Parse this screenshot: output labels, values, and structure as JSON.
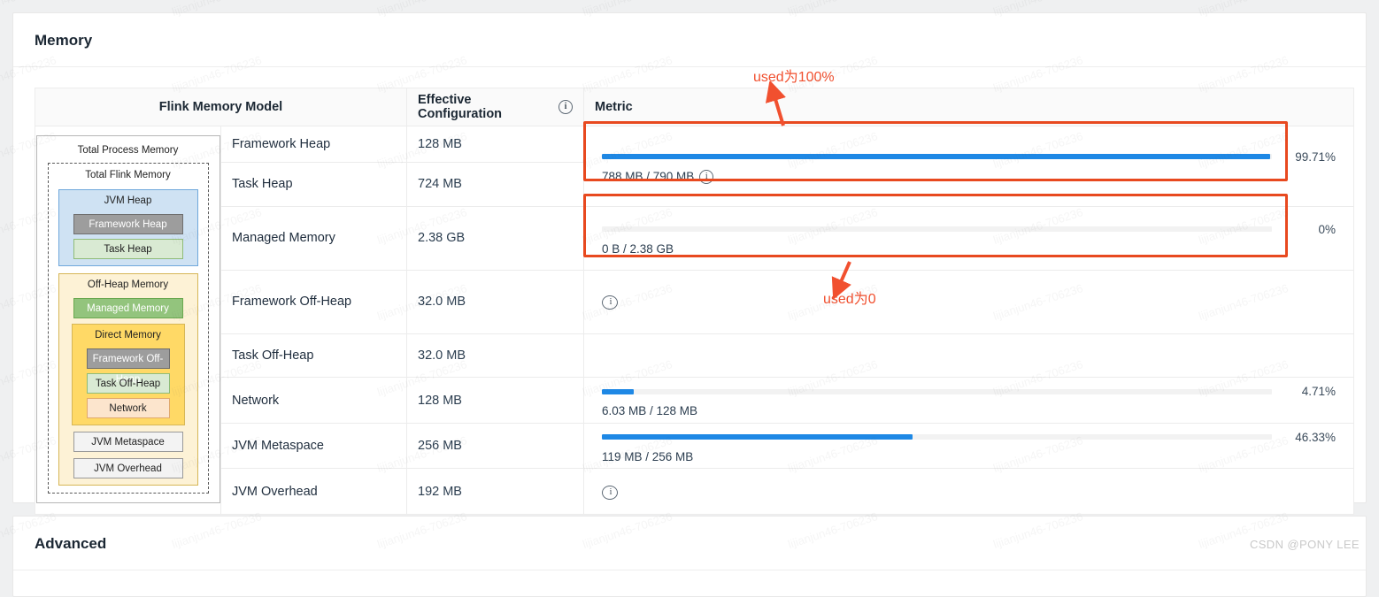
{
  "page": {
    "memory_title": "Memory",
    "advanced_title": "Advanced",
    "watermark": "CSDN @PONY LEE",
    "tile_watermark": "lijianjun46-706236"
  },
  "colors": {
    "bar_fill": "#1e88e5",
    "bar_track": "#f2f2f2",
    "highlight": "#e8491f",
    "annotation": "#f1502f",
    "jvm_heap": "#cfe2f3",
    "off_heap": "#fdf2d6",
    "direct_memory": "#ffd966",
    "framework_gray": "#9d9d9d",
    "task_green": "#d9ead3",
    "managed_green": "#93c47d",
    "network_peach": "#fce5cd",
    "plain_gray": "#f3f3f3"
  },
  "table": {
    "headers": {
      "model": "Flink Memory Model",
      "configuration": "Effective Configuration",
      "configuration_info_icon": "info-icon",
      "metric": "Metric"
    },
    "rows": [
      {
        "name": "Framework Heap",
        "configuration": "128 MB"
      },
      {
        "name": "Task Heap",
        "configuration": "724 MB"
      },
      {
        "name": "Managed Memory",
        "configuration": "2.38 GB"
      },
      {
        "name": "Framework Off-Heap",
        "configuration": "32.0 MB"
      },
      {
        "name": "Task Off-Heap",
        "configuration": "32.0 MB"
      },
      {
        "name": "Network",
        "configuration": "128 MB"
      },
      {
        "name": "JVM Metaspace",
        "configuration": "256 MB"
      },
      {
        "name": "JVM Overhead",
        "configuration": "192 MB"
      }
    ],
    "metrics": {
      "heap": {
        "percent_label": "99.71%",
        "percent_value": 99.71,
        "usage": "788 MB / 790 MB",
        "info_icon": "info-icon"
      },
      "managed": {
        "percent_label": "0%",
        "percent_value": 0,
        "usage": "0 B / 2.38 GB"
      },
      "off_heap_info": {
        "info_icon": "info-icon"
      },
      "network": {
        "percent_label": "4.71%",
        "percent_value": 4.71,
        "usage": "6.03 MB / 128 MB"
      },
      "metaspace": {
        "percent_label": "46.33%",
        "percent_value": 46.33,
        "usage": "119 MB / 256 MB"
      },
      "jvm_overhead_info": {
        "info_icon": "info-icon"
      }
    }
  },
  "diagram": {
    "total_process_memory": "Total Process Memory",
    "total_flink_memory": "Total Flink Memory",
    "jvm_heap": "JVM Heap",
    "framework_heap": "Framework Heap",
    "task_heap": "Task Heap",
    "off_heap_memory": "Off-Heap Memory",
    "managed_memory": "Managed Memory",
    "direct_memory": "Direct Memory",
    "framework_off_heap": "Framework Off-Heap",
    "task_off_heap": "Task Off-Heap",
    "network": "Network",
    "jvm_metaspace": "JVM Metaspace",
    "jvm_overhead": "JVM Overhead"
  },
  "annotations": {
    "used_100": "used为100%",
    "used_0": "used为0"
  }
}
